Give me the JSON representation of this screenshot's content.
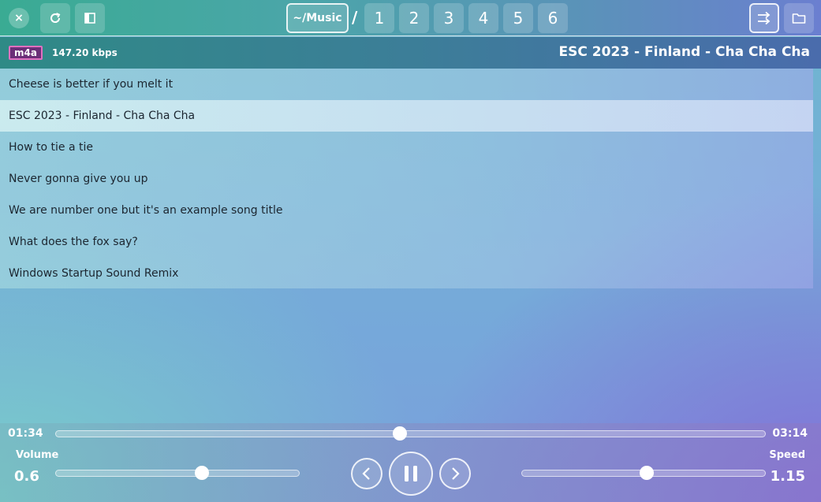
{
  "header": {
    "close_icon": "×",
    "reload_icon": "⟳",
    "path_label": "~/Music",
    "path_separator": "/",
    "tabs": [
      "1",
      "2",
      "3",
      "4",
      "5",
      "6"
    ]
  },
  "track": {
    "format": "m4a",
    "bitrate": "147.20 kbps",
    "title": "ESC 2023 - Finland - Cha Cha Cha"
  },
  "songs": [
    "Cheese is better if you melt it",
    "ESC 2023 - Finland - Cha Cha Cha",
    "How to tie a tie",
    "Never gonna give you up",
    "We are number one but it's an example song title",
    "What does the fox say?",
    "Windows Startup Sound Remix"
  ],
  "selected_song_index": 1,
  "player": {
    "elapsed": "01:34",
    "duration": "03:14",
    "progress_fraction": 0.48,
    "volume_label": "Volume",
    "volume_value": "0.6",
    "speed_label": "Speed",
    "speed_value": "1.15",
    "state": "playing"
  },
  "icons": {
    "close": "close-icon",
    "reload": "reload-icon",
    "sidebar": "sidebar-toggle-icon",
    "shuffle": "shuffle-icon",
    "folder": "folder-icon",
    "previous": "chevron-left-icon",
    "pause": "pause-icon",
    "next": "chevron-right-icon"
  }
}
